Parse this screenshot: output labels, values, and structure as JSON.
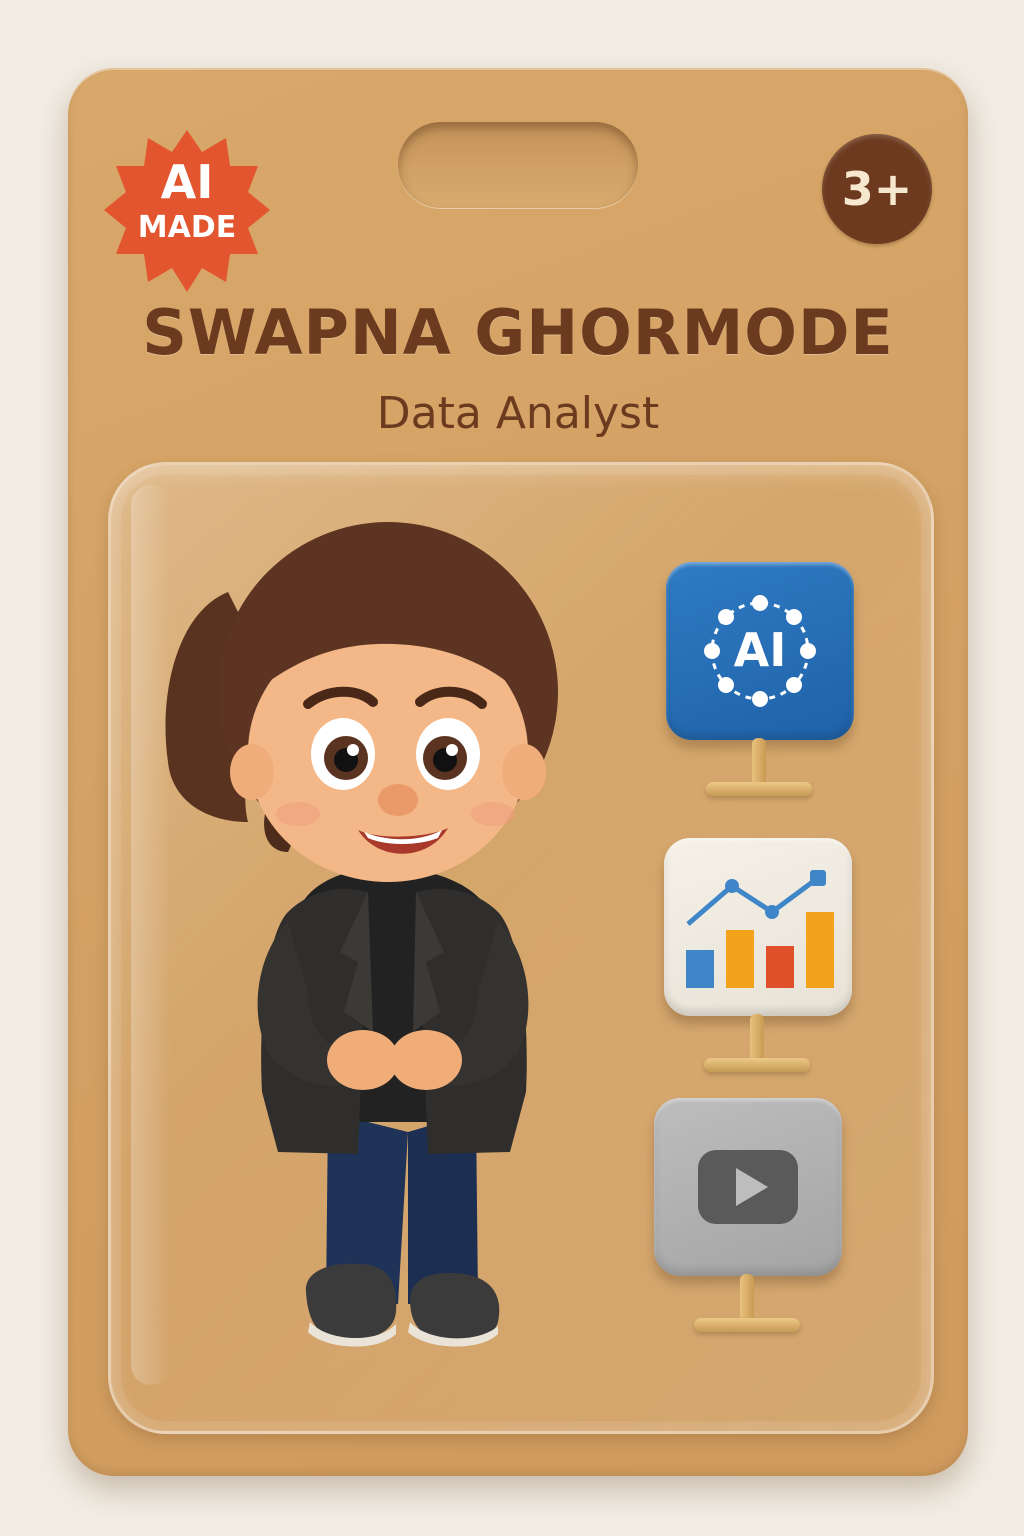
{
  "package": {
    "badge_line1": "AI",
    "badge_line2": "MADE",
    "age_rating": "3+",
    "name": "SWAPNA GHORMODE",
    "role": "Data Analyst"
  },
  "accessories": [
    {
      "icon": "ai-network-icon",
      "label": "AI"
    },
    {
      "icon": "bar-line-chart-icon"
    },
    {
      "icon": "video-play-icon"
    }
  ],
  "colors": {
    "card": "#d5a566",
    "title_brown": "#6b3a1f",
    "badge_red": "#e2552e",
    "ai_tile_blue": "#2a6fb8",
    "chart_blue": "#3f86c8",
    "chart_orange": "#f2a21b",
    "chart_red": "#e0502a"
  }
}
